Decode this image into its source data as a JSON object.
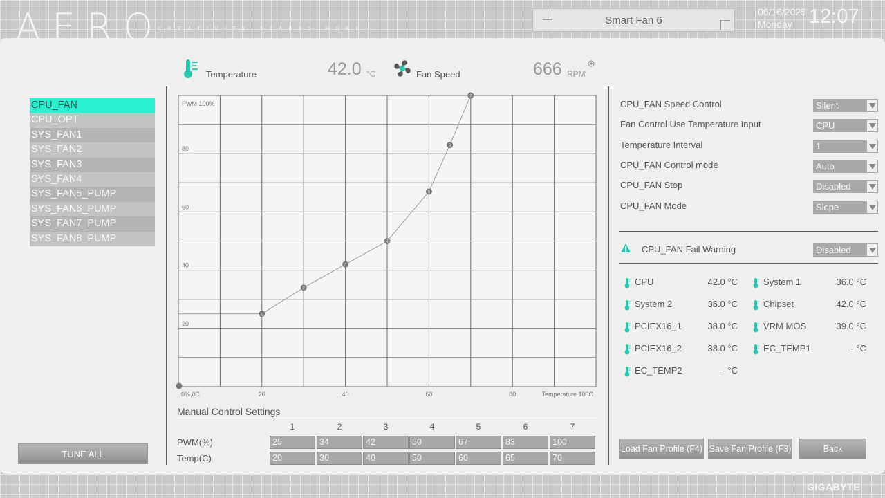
{
  "header": {
    "logo": "AERO",
    "tagline": "CREATIVITY STARTS HERE.",
    "title": "Smart Fan 6",
    "date": "06/16/2025",
    "weekday": "Monday",
    "time": "12:07",
    "brand": "GIGABYTE"
  },
  "readouts": {
    "temperature_label": "Temperature",
    "temperature_value": "42.0",
    "temperature_unit": "°C",
    "fan_speed_label": "Fan Speed",
    "fan_speed_value": "666",
    "fan_speed_unit": "RPM"
  },
  "fans": {
    "items": [
      "CPU_FAN",
      "CPU_OPT",
      "SYS_FAN1",
      "SYS_FAN2",
      "SYS_FAN3",
      "SYS_FAN4",
      "SYS_FAN5_PUMP",
      "SYS_FAN6_PUMP",
      "SYS_FAN7_PUMP",
      "SYS_FAN8_PUMP"
    ],
    "selected": "CPU_FAN"
  },
  "tune_all": "TUNE ALL",
  "chart_data": {
    "type": "line",
    "y_top_label": "PWM 100%",
    "x_origin_label": "0%,0C",
    "x_end_label": "Temperature 100C",
    "x_ticks": [
      "20",
      "40",
      "60",
      "80"
    ],
    "y_ticks": [
      "80",
      "60",
      "40",
      "20"
    ],
    "xlim": [
      0,
      100
    ],
    "ylim": [
      0,
      100
    ],
    "grid": true,
    "series": [
      {
        "values": [
          [
            0,
            25
          ],
          [
            20,
            25
          ],
          [
            30,
            34
          ],
          [
            40,
            42
          ],
          [
            50,
            50
          ],
          [
            60,
            67
          ],
          [
            65,
            83
          ],
          [
            70,
            100
          ]
        ]
      }
    ],
    "point_labels": [
      "1",
      "2",
      "3",
      "4",
      "5",
      "6",
      "7"
    ],
    "origin_point": [
      0,
      0
    ]
  },
  "manual": {
    "title": "Manual Control Settings",
    "columns": [
      "1",
      "2",
      "3",
      "4",
      "5",
      "6",
      "7"
    ],
    "pwm_label": "PWM(%)",
    "temp_label": "Temp(C)",
    "pwm": [
      "25",
      "34",
      "42",
      "50",
      "67",
      "83",
      "100"
    ],
    "temp": [
      "20",
      "30",
      "40",
      "50",
      "60",
      "65",
      "70"
    ]
  },
  "settings": [
    {
      "label": "CPU_FAN Speed Control",
      "value": "Silent"
    },
    {
      "label": "Fan Control Use Temperature Input",
      "value": "CPU"
    },
    {
      "label": "Temperature Interval",
      "value": "1"
    },
    {
      "label": "CPU_FAN Control mode",
      "value": "Auto"
    },
    {
      "label": "CPU_FAN Stop",
      "value": "Disabled"
    },
    {
      "label": "CPU_FAN Mode",
      "value": "Slope"
    }
  ],
  "fail_warning": {
    "label": "CPU_FAN Fail Warning",
    "value": "Disabled"
  },
  "temps": [
    {
      "name": "CPU",
      "value": "42.0 °C"
    },
    {
      "name": "System 1",
      "value": "36.0 °C"
    },
    {
      "name": "System 2",
      "value": "36.0 °C"
    },
    {
      "name": "Chipset",
      "value": "42.0 °C"
    },
    {
      "name": "PCIEX16_1",
      "value": "38.0 °C"
    },
    {
      "name": "VRM MOS",
      "value": "39.0 °C"
    },
    {
      "name": "PCIEX16_2",
      "value": "38.0 °C"
    },
    {
      "name": "EC_TEMP1",
      "value": "- °C"
    },
    {
      "name": "EC_TEMP2",
      "value": "- °C"
    }
  ],
  "buttons": {
    "load": "Load Fan Profile (F4)",
    "save": "Save Fan Profile (F3)",
    "back": "Back"
  },
  "colors": {
    "accent": "#27f1d1"
  }
}
